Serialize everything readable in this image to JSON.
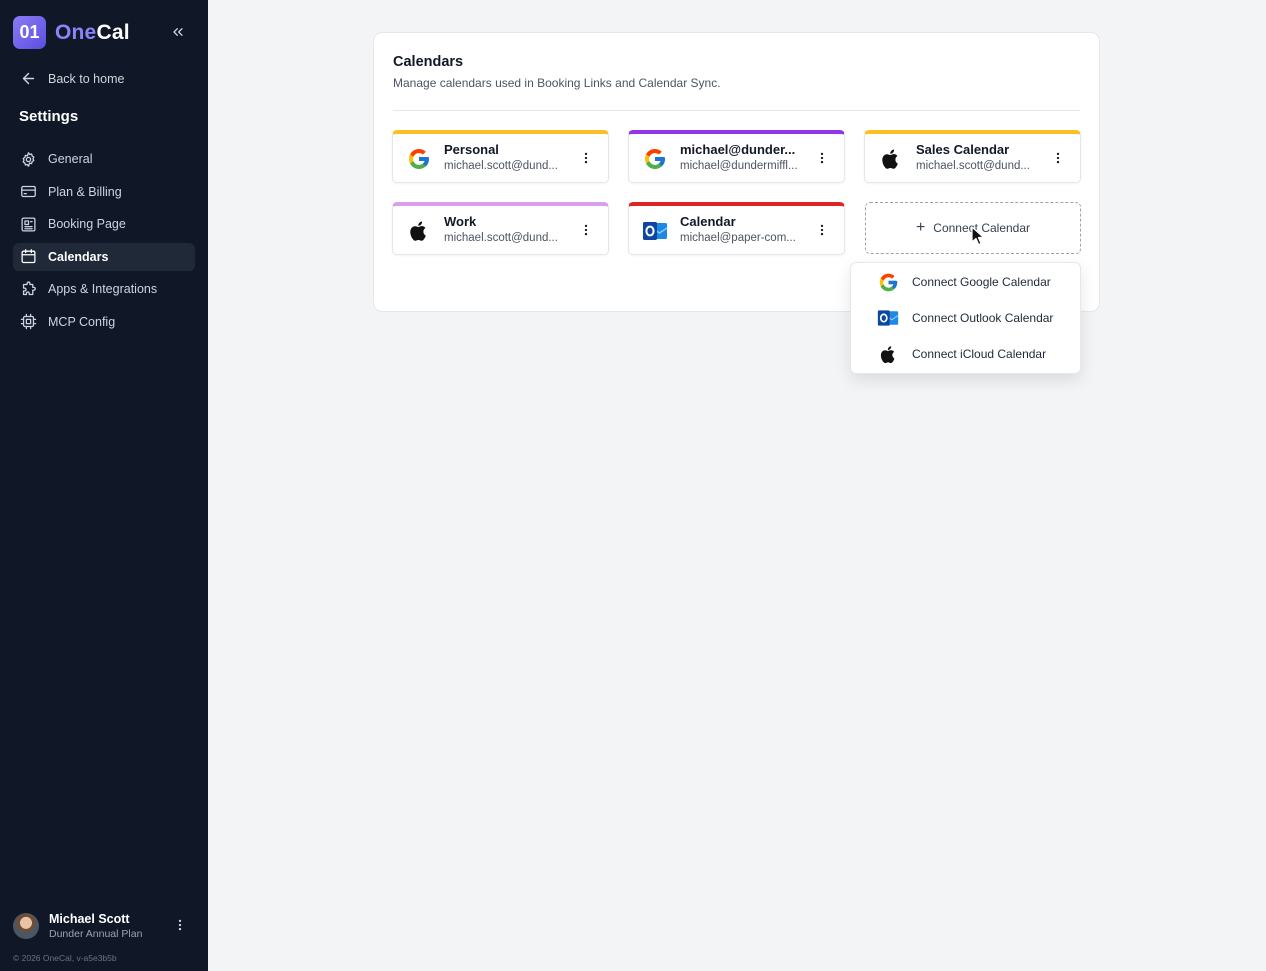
{
  "app": {
    "logo_text": "01",
    "name_part1": "One",
    "name_part2": "Cal"
  },
  "sidebar": {
    "back_label": "Back to home",
    "section_title": "Settings",
    "items": [
      {
        "label": "General",
        "icon": "gear-icon"
      },
      {
        "label": "Plan & Billing",
        "icon": "credit-card-icon"
      },
      {
        "label": "Booking Page",
        "icon": "booking-page-icon"
      },
      {
        "label": "Calendars",
        "icon": "calendar-icon",
        "active": true
      },
      {
        "label": "Apps & Integrations",
        "icon": "puzzle-icon"
      },
      {
        "label": "MCP Config",
        "icon": "chip-icon"
      }
    ],
    "user": {
      "name": "Michael Scott",
      "plan": "Dunder Annual Plan"
    },
    "footer": "© 2026 OneCal, v-a5e3b5b"
  },
  "main": {
    "title": "Calendars",
    "subtitle": "Manage calendars used in Booking Links and Calendar Sync.",
    "calendars": [
      {
        "name": "Personal",
        "email": "michael.scott@dund...",
        "provider": "google-icon",
        "color": "#fbbf24"
      },
      {
        "name": "michael@dunder...",
        "email": "michael@dundermiffl...",
        "provider": "google-icon",
        "color": "#9333ea"
      },
      {
        "name": "Sales Calendar",
        "email": "michael.scott@dund...",
        "provider": "apple-icon",
        "color": "#fbbf24"
      },
      {
        "name": "Work",
        "email": "michael.scott@dund...",
        "provider": "apple-icon",
        "color": "#d8a0e8"
      },
      {
        "name": "Calendar",
        "email": "michael@paper-com...",
        "provider": "outlook-icon",
        "color": "#dc2626"
      }
    ],
    "connect_label": "Connect Calendar",
    "dropdown": [
      {
        "label": "Connect Google Calendar",
        "icon": "google-icon"
      },
      {
        "label": "Connect Outlook Calendar",
        "icon": "outlook-icon"
      },
      {
        "label": "Connect iCloud Calendar",
        "icon": "apple-icon"
      }
    ]
  }
}
